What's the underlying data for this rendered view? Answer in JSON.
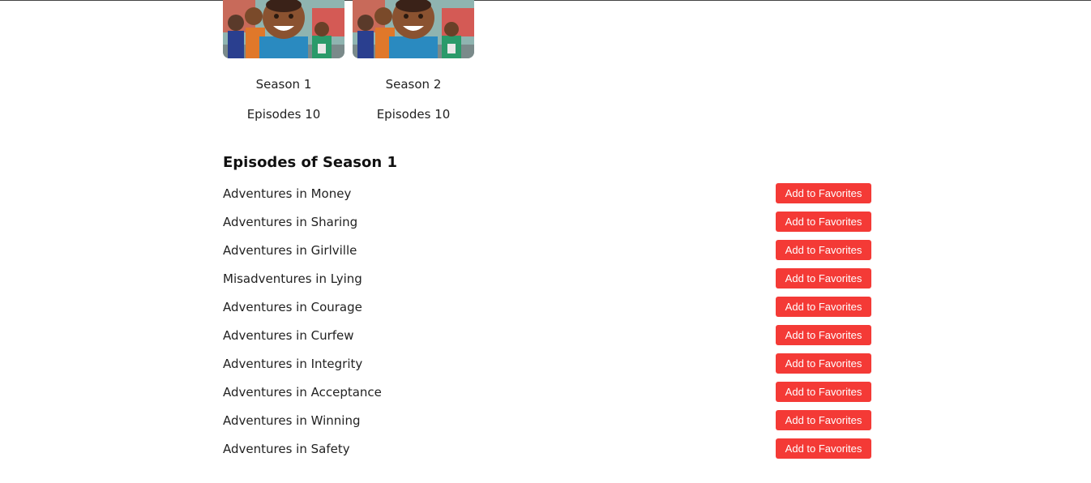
{
  "seasons": [
    {
      "label": "Season 1",
      "episodes_text": "Episodes 10"
    },
    {
      "label": "Season 2",
      "episodes_text": "Episodes 10"
    }
  ],
  "episodes_section": {
    "title": "Episodes of Season 1",
    "button_label": "Add to Favorites",
    "items": [
      "Adventures in Money",
      "Adventures in Sharing",
      "Adventures in Girlville",
      "Misadventures in Lying",
      "Adventures in Courage",
      "Adventures in Curfew",
      "Adventures in Integrity",
      "Adventures in Acceptance",
      "Adventures in Winning",
      "Adventures in Safety"
    ]
  },
  "colors": {
    "button_bg": "#f43a36",
    "button_text": "#ffffff"
  }
}
